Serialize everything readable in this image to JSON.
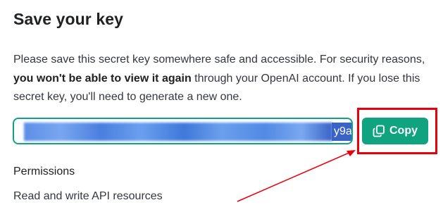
{
  "dialog": {
    "title": "Save your key",
    "description": {
      "part1": "Please save this secret key somewhere safe and accessible. For security reasons, ",
      "bold": "you won't be able to view it again",
      "part2": " through your OpenAI account. If you lose this secret key, you'll need to generate a new one."
    },
    "key_field": {
      "visible_suffix": "y9a"
    },
    "copy_button": {
      "label": "Copy",
      "icon": "copy-icon"
    },
    "permissions": {
      "label": "Permissions",
      "value": "Read and write API resources"
    }
  },
  "annotation": {
    "highlight_color": "#e8000b",
    "arrow_color": "#e8000b"
  },
  "colors": {
    "accent": "#10a37f",
    "selection": "#3a63c7"
  }
}
